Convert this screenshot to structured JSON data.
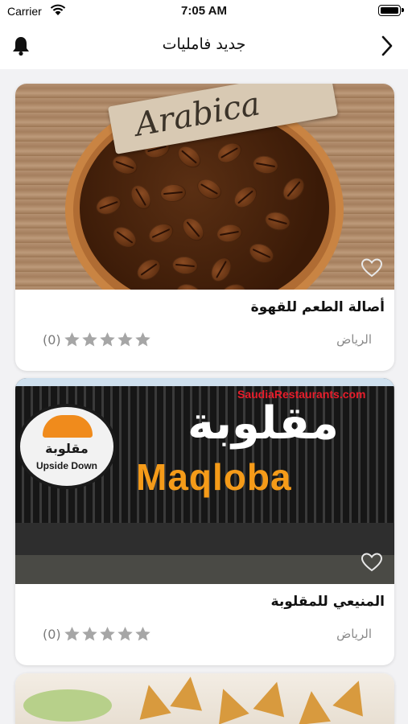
{
  "status_bar": {
    "carrier": "Carrier",
    "time": "7:05 AM"
  },
  "nav": {
    "title": "جديد فامليات",
    "bell_icon": "bell-icon",
    "back_icon": "chevron-right-icon"
  },
  "cards": [
    {
      "name": "أصالة الطعم للقهوة",
      "city": "الرياض",
      "rating_count": "(0)",
      "stars_filled": 0,
      "stars_total": 5,
      "photo": {
        "tag_text": "Arabica"
      }
    },
    {
      "name": "المنيعي للمقلوبة",
      "city": "الرياض",
      "rating_count": "(0)",
      "stars_filled": 0,
      "stars_total": 5,
      "photo": {
        "watermark": "SaudiaRestaurants.com",
        "sign_arabic": "مقلوبة",
        "sign_latin": "Maqloba",
        "logo_arabic": "مقلوبة",
        "logo_latin": "Upside Down"
      }
    }
  ],
  "colors": {
    "star": "#a6a6a6",
    "accent_orange": "#f59b19",
    "watermark_red": "#e81d2b"
  }
}
